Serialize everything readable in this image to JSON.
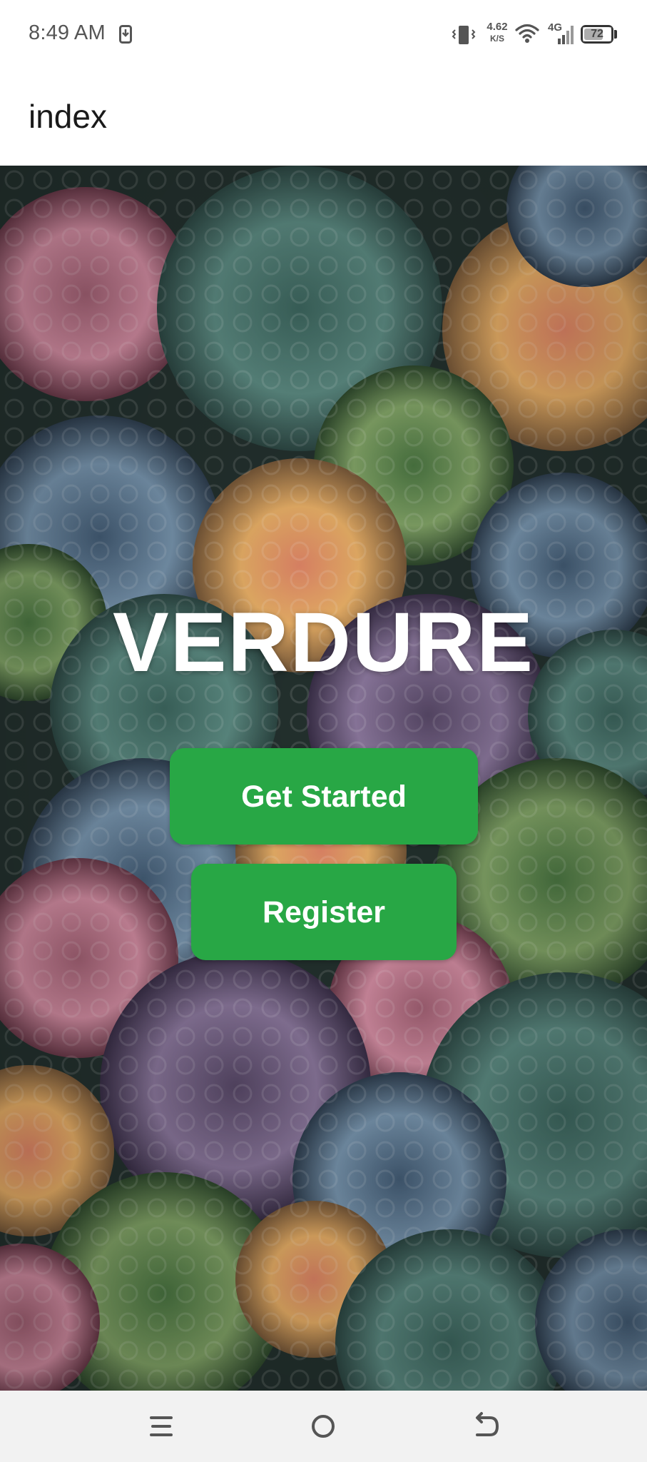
{
  "status_bar": {
    "time": "8:49 AM",
    "net_speed_value": "4.62",
    "net_speed_unit": "K/S",
    "network_type": "4G",
    "battery_level": "72",
    "battery_fraction": 0.72,
    "icons": [
      "download-notification-icon",
      "vibrate-icon",
      "wifi-icon",
      "signal-icon",
      "battery-icon"
    ]
  },
  "header": {
    "title": "index"
  },
  "hero": {
    "brand": "VERDURE",
    "get_started_label": "Get Started",
    "register_label": "Register"
  },
  "nav_bar": {
    "icons": [
      "menu-icon",
      "home-icon",
      "back-icon"
    ]
  },
  "colors": {
    "button": "#28a745",
    "brand_text": "#ffffff",
    "header_bg": "#ffffff",
    "nav_bg": "#f2f2f2"
  }
}
